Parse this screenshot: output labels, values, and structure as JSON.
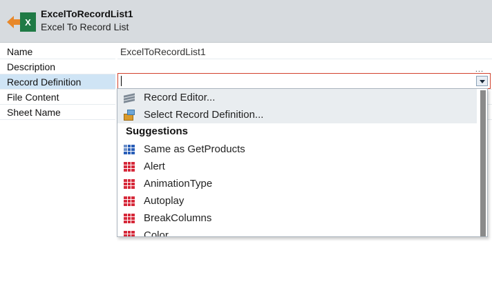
{
  "header": {
    "title": "ExcelToRecordList1",
    "subtitle": "Excel To Record List",
    "icon": "excel-to-record-list-icon",
    "icon_letter": "X",
    "colors": {
      "arrow": "#e8882a",
      "excel": "#1f7a45"
    }
  },
  "properties": [
    {
      "name": "Name",
      "value": "ExcelToRecordList1"
    },
    {
      "name": "Description",
      "value": "",
      "ellipsis": "..."
    },
    {
      "name": "Record Definition",
      "value": ""
    },
    {
      "name": "File Content",
      "value": ""
    },
    {
      "name": "Sheet Name",
      "value": ""
    }
  ],
  "dropdown": {
    "actions": [
      {
        "label": "Record Editor...",
        "icon": "record-editor-icon"
      },
      {
        "label": "Select Record Definition...",
        "icon": "select-record-definition-icon"
      }
    ],
    "suggestions_heading": "Suggestions",
    "suggestions": [
      {
        "label": "Same as GetProducts",
        "icon": "record-list-blue-icon"
      },
      {
        "label": "Alert",
        "icon": "record-table-icon"
      },
      {
        "label": "AnimationType",
        "icon": "record-table-icon"
      },
      {
        "label": "Autoplay",
        "icon": "record-table-icon"
      },
      {
        "label": "BreakColumns",
        "icon": "record-table-icon"
      },
      {
        "label": "Color",
        "icon": "record-table-icon"
      }
    ]
  },
  "colors": {
    "selected_row": "#cfe4f5",
    "error_border": "#d2402a"
  }
}
